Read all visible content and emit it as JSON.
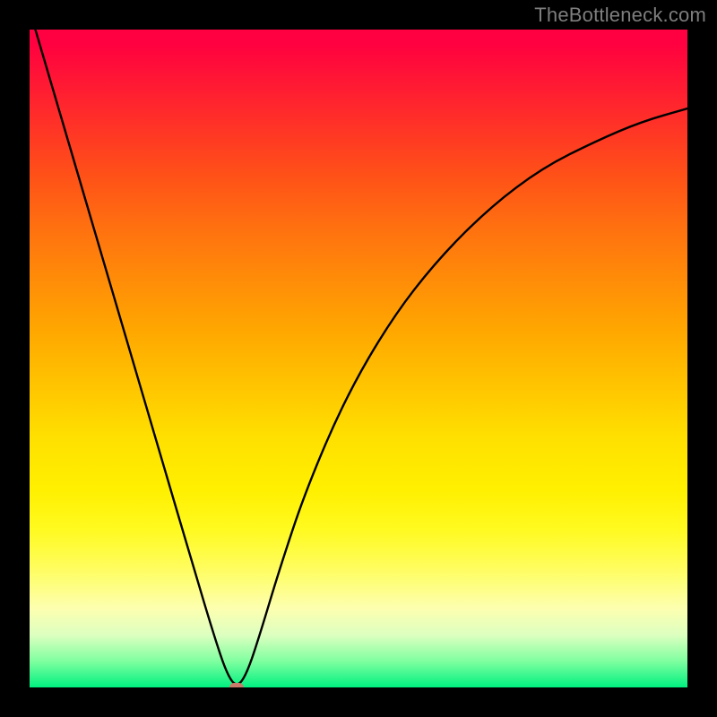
{
  "watermark": "TheBottleneck.com",
  "chart_data": {
    "type": "line",
    "title": "",
    "xlabel": "",
    "ylabel": "",
    "xlim": [
      0,
      1
    ],
    "ylim": [
      0,
      1
    ],
    "grid": false,
    "legend": false,
    "background": "red-yellow-green vertical gradient",
    "series": [
      {
        "name": "bottleneck-curve",
        "x": [
          0.0,
          0.05,
          0.1,
          0.15,
          0.2,
          0.25,
          0.28,
          0.3,
          0.315,
          0.33,
          0.35,
          0.38,
          0.42,
          0.48,
          0.55,
          0.62,
          0.7,
          0.78,
          0.86,
          0.93,
          1.0
        ],
        "y": [
          1.03,
          0.86,
          0.69,
          0.52,
          0.35,
          0.18,
          0.08,
          0.02,
          0.0,
          0.02,
          0.08,
          0.18,
          0.3,
          0.44,
          0.56,
          0.65,
          0.73,
          0.79,
          0.83,
          0.86,
          0.88
        ]
      }
    ],
    "marker": {
      "x": 0.315,
      "y": 0.0,
      "color": "#c97a6a"
    },
    "note": "V-shaped bottleneck curve; minimum (optimal pairing) near x≈0.315. Left branch descends linearly from above frame; right branch rises with decreasing slope (concave)."
  },
  "colors": {
    "frame": "#000000",
    "watermark": "#7e7e7e",
    "curve": "#000000",
    "marker": "#c97a6a"
  }
}
